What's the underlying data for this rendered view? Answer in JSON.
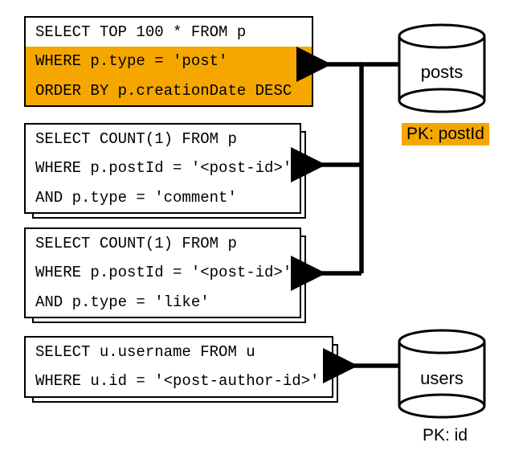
{
  "query1": {
    "line1": "SELECT TOP 100 * FROM p",
    "line2": "WHERE p.type = 'post'",
    "line3": "ORDER BY p.creationDate DESC"
  },
  "query2": {
    "line1": "SELECT COUNT(1) FROM p",
    "line2": "WHERE p.postId = '<post-id>'",
    "line3": "AND p.type = 'comment'"
  },
  "query3": {
    "line1": "SELECT COUNT(1) FROM p",
    "line2": "WHERE p.postId = '<post-id>'",
    "line3": "AND p.type = 'like'"
  },
  "query4": {
    "line1": "SELECT u.username FROM u",
    "line2": "WHERE u.id = '<post-author-id>'"
  },
  "db1": {
    "label": "posts",
    "pk": "PK: postId"
  },
  "db2": {
    "label": "users",
    "pk": "PK: id"
  }
}
